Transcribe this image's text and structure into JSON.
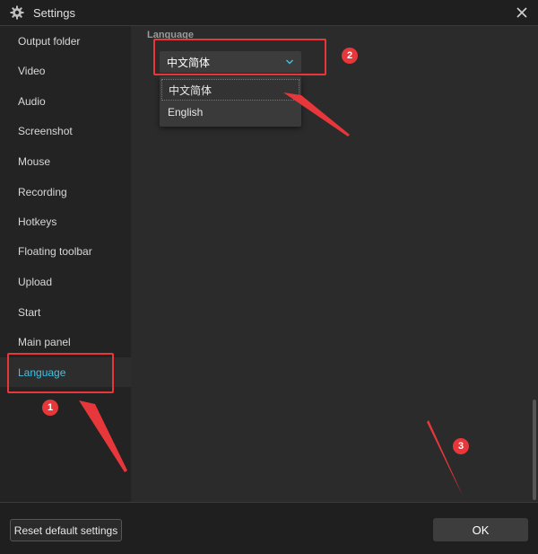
{
  "window": {
    "title": "Settings",
    "icon": "gear-icon",
    "close_icon": "close-icon"
  },
  "sidebar": {
    "items": [
      {
        "label": "Output folder"
      },
      {
        "label": "Video"
      },
      {
        "label": "Audio"
      },
      {
        "label": "Screenshot"
      },
      {
        "label": "Mouse"
      },
      {
        "label": "Recording"
      },
      {
        "label": "Hotkeys"
      },
      {
        "label": "Floating toolbar"
      },
      {
        "label": "Upload"
      },
      {
        "label": "Start"
      },
      {
        "label": "Main panel"
      },
      {
        "label": "Language",
        "active": true
      }
    ]
  },
  "language": {
    "section_label": "Language",
    "selected": "中文简体",
    "options": [
      "中文简体",
      "English"
    ]
  },
  "footer": {
    "reset_label": "Reset default settings",
    "ok_label": "OK"
  },
  "annotations": {
    "badges": [
      "1",
      "2",
      "3"
    ]
  },
  "colors": {
    "accent": "#3ec3e8",
    "annotation_red": "#e8373b",
    "background": "#2b2b2b",
    "sidebar_bg": "#232323"
  }
}
